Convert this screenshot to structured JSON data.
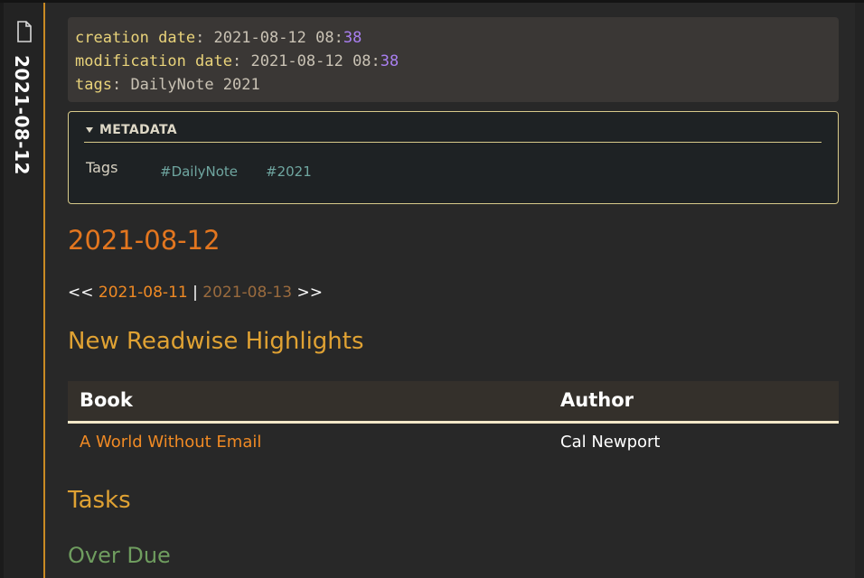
{
  "sidebar": {
    "file_icon": "file-icon",
    "note_title": "2021-08-12"
  },
  "frontmatter": {
    "creation": {
      "key": "creation date",
      "value_prefix": " 2021-08-12 08:",
      "value_num": "38"
    },
    "modification": {
      "key": "modification date",
      "value_prefix": " 2021-08-12 08:",
      "value_num": "38"
    },
    "tags": {
      "key": "tags",
      "value": " DailyNote 2021"
    }
  },
  "metadata": {
    "heading": "METADATA",
    "label": "Tags",
    "tags": [
      "#DailyNote",
      "#2021"
    ]
  },
  "note": {
    "title": "2021-08-12",
    "nav": {
      "prefix": "<< ",
      "prev": "2021-08-11",
      "separator": " | ",
      "next": "2021-08-13",
      "suffix": " >>"
    },
    "readwise_heading": "New Readwise Highlights",
    "table": {
      "headers": [
        "Book",
        "Author"
      ],
      "rows": [
        {
          "book": "A World Without Email",
          "author": "Cal Newport"
        }
      ]
    },
    "tasks_heading": "Tasks",
    "overdue_heading": "Over Due"
  },
  "colors": {
    "accent": "#c98a23",
    "link": "#f08a24",
    "heading_orange": "#e3761f",
    "heading_gold": "#e0a233",
    "heading_green": "#6f9d5f",
    "tag": "#6fa6a0"
  }
}
